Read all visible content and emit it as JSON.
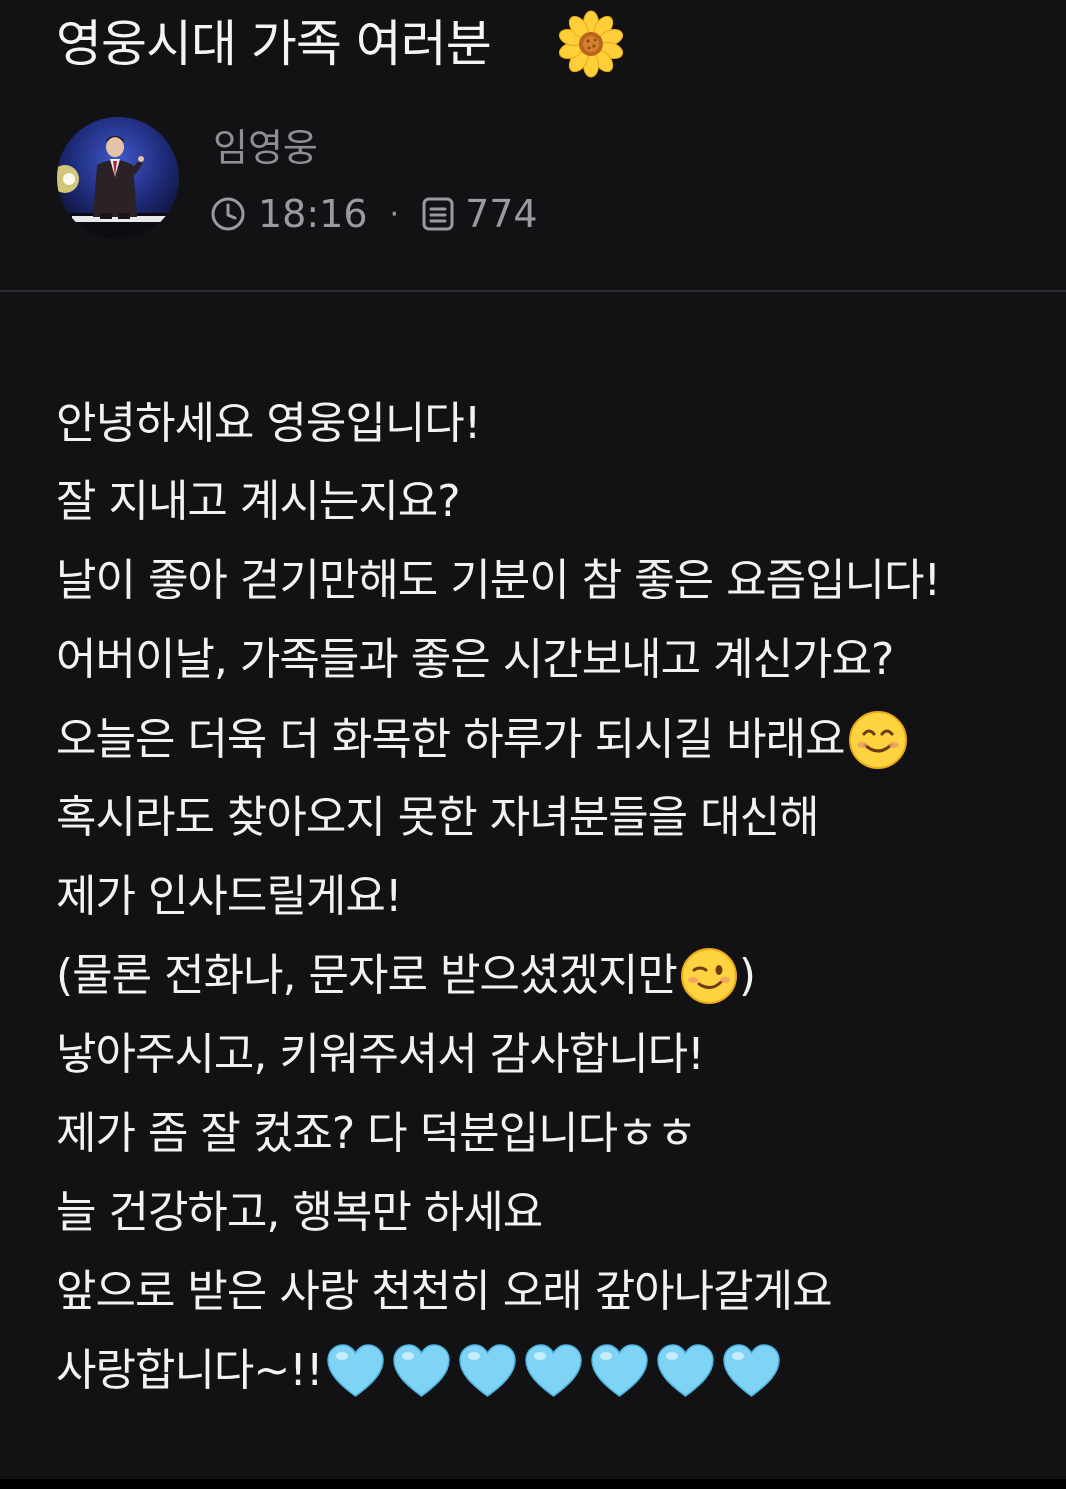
{
  "post": {
    "title": "영웅시대 가족 여러분",
    "title_emoji": "sunflower",
    "author": "임영웅",
    "time": "18:16",
    "separator": "·",
    "views": "774",
    "time_icon": "clock-icon",
    "views_icon": "document-icon"
  },
  "body": {
    "line1": "안녕하세요 영웅입니다!",
    "line2": "잘 지내고 계시는지요?",
    "line3": "날이 좋아 걷기만해도 기분이 참 좋은 요즘입니다!",
    "line4": "어버이날, 가족들과 좋은 시간보내고 계신가요?",
    "line5": "오늘은 더욱 더 화목한 하루가 되시길 바래요",
    "line6": "혹시라도 찾아오지 못한 자녀분들을 대신해",
    "line7": "제가 인사드릴게요!",
    "line8_a": "(물론 전화나, 문자로 받으셨겠지만",
    "line8_b": ")",
    "line9": "낳아주시고, 키워주셔서 감사합니다!",
    "line10": "제가 좀 잘 컸죠? 다 덕분입니다ㅎㅎ",
    "line11": "늘 건강하고, 행복만 하세요",
    "line12": "앞으로 받은 사랑 천천히 오래 갚아나갈게요",
    "line13": "사랑합니다~!!",
    "emoji_line5": "smiling-face",
    "emoji_line8": "winking-face",
    "hearts_count": 7,
    "heart_color": "#7fd3f5"
  },
  "colors": {
    "background": "#121215",
    "text": "#f2f2f2",
    "meta": "#9a9aa0",
    "divider": "#2c2c31"
  }
}
